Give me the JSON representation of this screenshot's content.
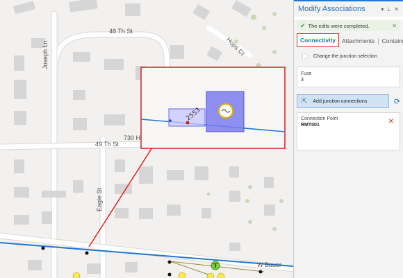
{
  "map": {
    "streets": {
      "s48th": "48 Th St",
      "s49th": "49 Th St",
      "s730": "730 H",
      "joseph": "Joseph Ln",
      "eagle": "Eagle St",
      "wbauer": "W Bauer",
      "hops": "Hops Ct"
    },
    "feature_label": "2553",
    "marker_label": "T"
  },
  "panel": {
    "title": "Modify Associations",
    "notice": "The edits were completed.",
    "tabs": {
      "connectivity": "Connectivity",
      "attachments": "Attachments",
      "containment": "Containment"
    },
    "junction_selection": "Change the junction selection",
    "fuse": {
      "label": "Fuse",
      "value": "3"
    },
    "add_button": "Add junction connections",
    "connection_point": {
      "label": "Connection Point",
      "value": "RMT001"
    }
  },
  "colors": {
    "accent": "#1f78d1",
    "highlight": "#d0342c",
    "selection": "#7d7df0",
    "success": "#3c9a3c"
  }
}
